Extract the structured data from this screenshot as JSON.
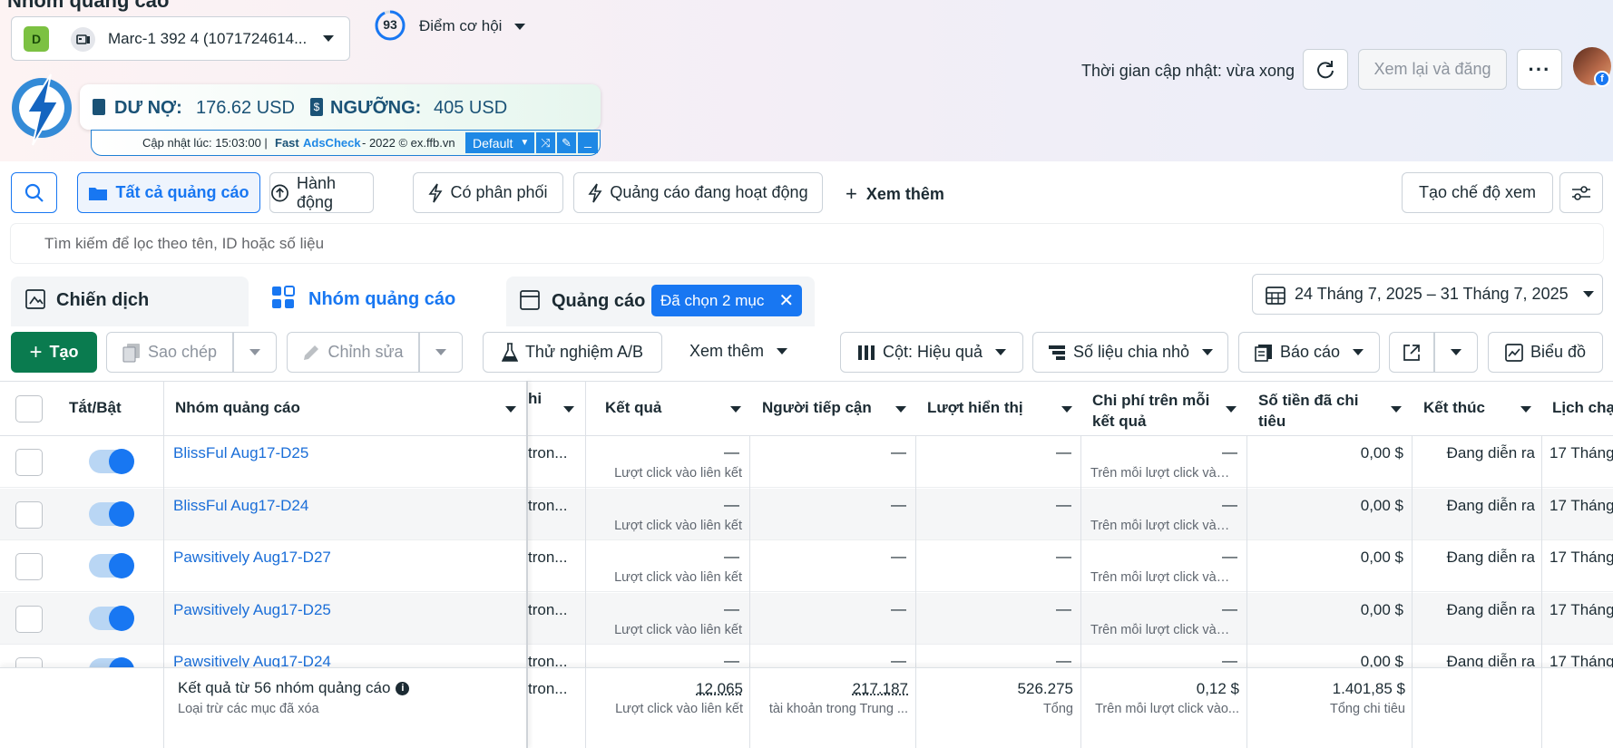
{
  "header": {
    "title": "Nhóm quảng cáo",
    "account_badge": "D",
    "account_name": "Marc-1 392 4 (1071724614...",
    "score": "93",
    "opportunity": "Điểm cơ hội",
    "update_time": "Thời gian cập nhật: vừa xong",
    "review_publish": "Xem lại và đăng"
  },
  "adscheck": {
    "debt_label": "DƯ NỢ:",
    "debt_value": "176.62 USD",
    "threshold_label": "NGƯỠNG:",
    "threshold_value": "405 USD",
    "update_prefix": "Cập nhật lúc: 15:03:00 |",
    "brand1": "Fast",
    "brand2": "AdsCheck",
    "suffix": "- 2022 © ex.ffb.vn",
    "mode": "Default"
  },
  "filters": {
    "all_ads": "Tất cả quảng cáo",
    "actions": "Hành động",
    "delivery": "Có phân phối",
    "active_ads": "Quảng cáo đang hoạt động",
    "see_more": "Xem thêm",
    "create_view": "Tạo chế độ xem",
    "search_placeholder": "Tìm kiếm để lọc theo tên, ID hoặc số liệu"
  },
  "tabs": {
    "campaign": "Chiến dịch",
    "adsets": "Nhóm quảng cáo",
    "ads": "Quảng cáo",
    "selected": "Đã chọn 2 mục"
  },
  "date_range": "24 Tháng 7, 2025 – 31 Tháng 7, 2025",
  "toolbar": {
    "create": "Tạo",
    "copy": "Sao chép",
    "edit": "Chỉnh sửa",
    "ab_test": "Thử nghiệm A/B",
    "see_more": "Xem thêm",
    "columns": "Cột: Hiệu quả",
    "breakdown": "Số liệu chia nhỏ",
    "report": "Báo cáo",
    "chart": "Biểu đồ"
  },
  "columns": {
    "toggle": "Tắt/Bật",
    "name": "Nhóm quảng cáo",
    "partial": "hi",
    "results": "Kết quả",
    "reach": "Người tiếp cận",
    "impressions": "Lượt hiển thị",
    "cost_per_result_1": "Chi phí trên mỗi",
    "cost_per_result_2": "kết quả",
    "spent_1": "Số tiền đã chi",
    "spent_2": "tiêu",
    "end": "Kết thúc",
    "schedule": "Lịch chạ"
  },
  "rows": [
    {
      "name": "BlissFul Aug17-D25",
      "partial": "tron...",
      "result": "—",
      "result_sub": "Lượt click vào liên kết",
      "reach": "—",
      "impressions": "—",
      "cpr": "—",
      "cpr_sub": "Trên mỗi lượt click vào...",
      "spent": "0,00 $",
      "end": "Đang diễn ra",
      "schedule": "17 Tháng"
    },
    {
      "name": "BlissFul Aug17-D24",
      "partial": "tron...",
      "result": "—",
      "result_sub": "Lượt click vào liên kết",
      "reach": "—",
      "impressions": "—",
      "cpr": "—",
      "cpr_sub": "Trên mỗi lượt click vào...",
      "spent": "0,00 $",
      "end": "Đang diễn ra",
      "schedule": "17 Tháng"
    },
    {
      "name": "Pawsitively Aug17-D27",
      "partial": "tron...",
      "result": "—",
      "result_sub": "Lượt click vào liên kết",
      "reach": "—",
      "impressions": "—",
      "cpr": "—",
      "cpr_sub": "Trên mỗi lượt click vào...",
      "spent": "0,00 $",
      "end": "Đang diễn ra",
      "schedule": "17 Tháng"
    },
    {
      "name": "Pawsitively Aug17-D25",
      "partial": "tron...",
      "result": "—",
      "result_sub": "Lượt click vào liên kết",
      "reach": "—",
      "impressions": "—",
      "cpr": "—",
      "cpr_sub": "Trên mỗi lượt click vào...",
      "spent": "0,00 $",
      "end": "Đang diễn ra",
      "schedule": "17 Tháng"
    },
    {
      "name": "Pawsitively Aug17-D24",
      "partial": "tron...",
      "result": "—",
      "result_sub": "Lượt click vào liên kết",
      "reach": "—",
      "impressions": "—",
      "cpr": "—",
      "cpr_sub": "Trên mỗi lượt click vào...",
      "spent": "0,00 $",
      "end": "Đang diễn ra",
      "schedule": "17 Tháng"
    }
  ],
  "summary": {
    "label": "Kết quả từ 56 nhóm quảng cáo",
    "note": "Loại trừ các mục đã xóa",
    "partial": "tron...",
    "results": "12.065",
    "results_sub": "Lượt click vào liên kết",
    "reach": "217.187",
    "reach_sub": "tài khoản trong Trung ...",
    "impressions": "526.275",
    "impressions_sub": "Tổng",
    "cpr": "0,12 $",
    "cpr_sub": "Trên mỗi lượt click vào...",
    "spent": "1.401,85 $",
    "spent_sub": "Tổng chi tiêu"
  }
}
